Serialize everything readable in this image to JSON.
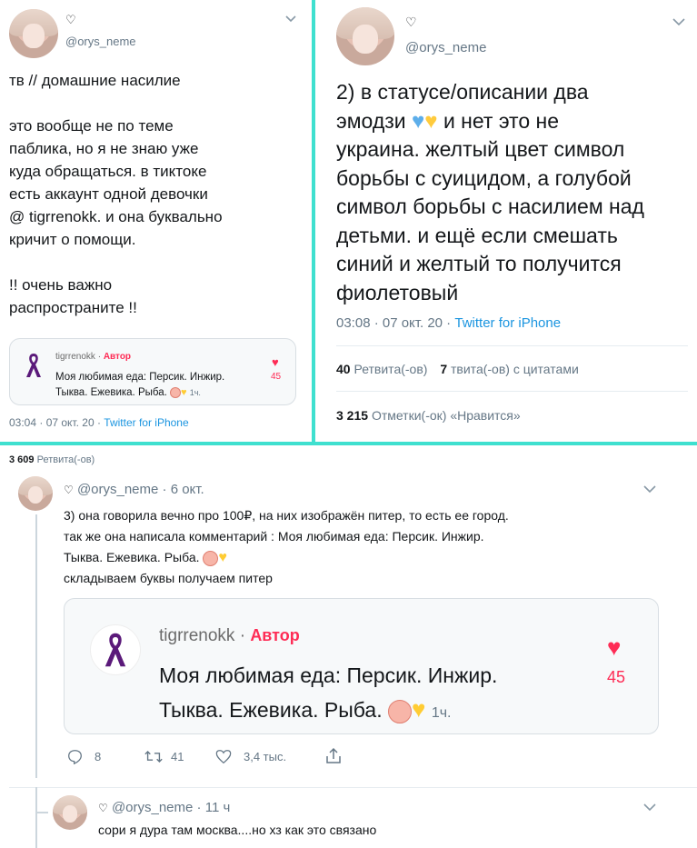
{
  "tweet1": {
    "name": "♡",
    "handle": "@orys_neme",
    "line1": "тв // домашние насилие",
    "para1": [
      "это вообще не по теме",
      "паблика, но я не знаю уже",
      "куда обращаться. в тиктоке",
      "есть аккаунт одной девочки",
      "@ tigrrenokk. и она буквально",
      "кричит о помощи."
    ],
    "para2": [
      "!! очень важно",
      "распространите !!"
    ],
    "card": {
      "author": "tigrrenokk",
      "tag": "Автор",
      "sep": "·",
      "line1": "Моя любимая еда: Персик. Инжир.",
      "line2": "Тыква. Ежевика. Рыба.",
      "time": "1ч.",
      "likes": "45"
    },
    "timestamp": "03:04 · 07 окт. 20 · ",
    "source": "Twitter for iPhone"
  },
  "tweet2": {
    "name": "♡",
    "handle": "@orys_neme",
    "lines": [
      "2) в статусе/описании два",
      "эмодзи",
      "и нет это не",
      "украина. желтый цвет символ",
      "борьбы с суицидом, а голубой",
      "символ борьбы с насилием над",
      "детьми. и ещё если смешать",
      "синий и желтый то получится",
      "фиолетовый"
    ],
    "timestamp": "03:08 · 07 окт. 20 · ",
    "source": "Twitter for iPhone",
    "retweets_count": "40",
    "retweets_label": "Ретвита(-ов)",
    "quotes_count": "7",
    "quotes_label": "твита(-ов) с цитатами",
    "likes_count": "3 215",
    "likes_label": "Отметки(-ок) «Нравится»"
  },
  "strip": {
    "count": "3 609",
    "label": "Ретвита(-ов)"
  },
  "tweet3": {
    "name": "♡",
    "handle": "@orys_neme",
    "date": "· 6 окт.",
    "lines": [
      "3) она говорила вечно про 100₽, на них изображён питер, то есть ее город.",
      "так же она написала комментарий : Моя любимая еда: Персик. Инжир.",
      "Тыква. Ежевика. Рыба.",
      "складываем буквы получаем питер"
    ],
    "card": {
      "author": "tigrrenokk",
      "tag": "Автор",
      "sep": "·",
      "line1": "Моя любимая еда: Персик. Инжир.",
      "line2": "Тыква. Ежевика. Рыба.",
      "time": "1ч.",
      "likes": "45"
    },
    "actions": {
      "replies": "8",
      "retweets": "41",
      "likes": "3,4 тыс."
    }
  },
  "tweet4": {
    "name": "♡",
    "handle": "@orys_neme",
    "date": "· 11 ч",
    "text": "сори я дура там москва....но хз как это связано"
  },
  "colors": {
    "accent": "#1b95e0",
    "tiktok_red": "#fe2c55",
    "divider": "#3fe0cf",
    "ribbon": "#5b1a7a"
  }
}
